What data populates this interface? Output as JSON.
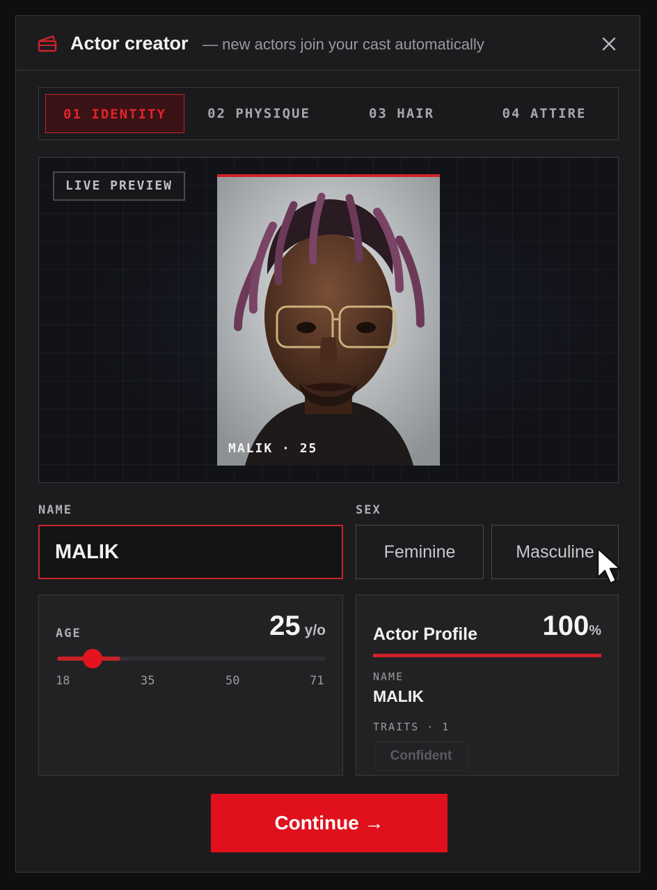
{
  "header": {
    "title": "Actor creator",
    "subtitle": "— new actors join your cast automatically",
    "accent_color": "#d1222b"
  },
  "tabs": [
    {
      "label": "01 IDENTITY",
      "active": true
    },
    {
      "label": "02 PHYSIQUE",
      "active": false
    },
    {
      "label": "03 HAIR",
      "active": false
    },
    {
      "label": "04 ATTIRE",
      "active": false
    }
  ],
  "preview": {
    "badge": "LIVE PREVIEW",
    "caption": "MALIK · 25"
  },
  "name_field": {
    "label": "NAME",
    "value": "MALIK"
  },
  "sex": {
    "label": "SEX",
    "options": [
      "Feminine",
      "Masculine"
    ]
  },
  "age": {
    "label": "AGE",
    "value": "25",
    "unit": "y/o",
    "min": 18,
    "max": 71,
    "current": 25,
    "ticks": [
      "18",
      "35",
      "50",
      "71"
    ]
  },
  "profile": {
    "title": "Actor Profile",
    "percent": "100",
    "percent_unit": "%",
    "name_label": "NAME",
    "name_value": "MALIK",
    "traits_label": "TRAITS · 1",
    "traits": [
      "Confident"
    ]
  },
  "continue_button": {
    "label": "Continue",
    "arrow": "→",
    "color": "#e0101c"
  }
}
